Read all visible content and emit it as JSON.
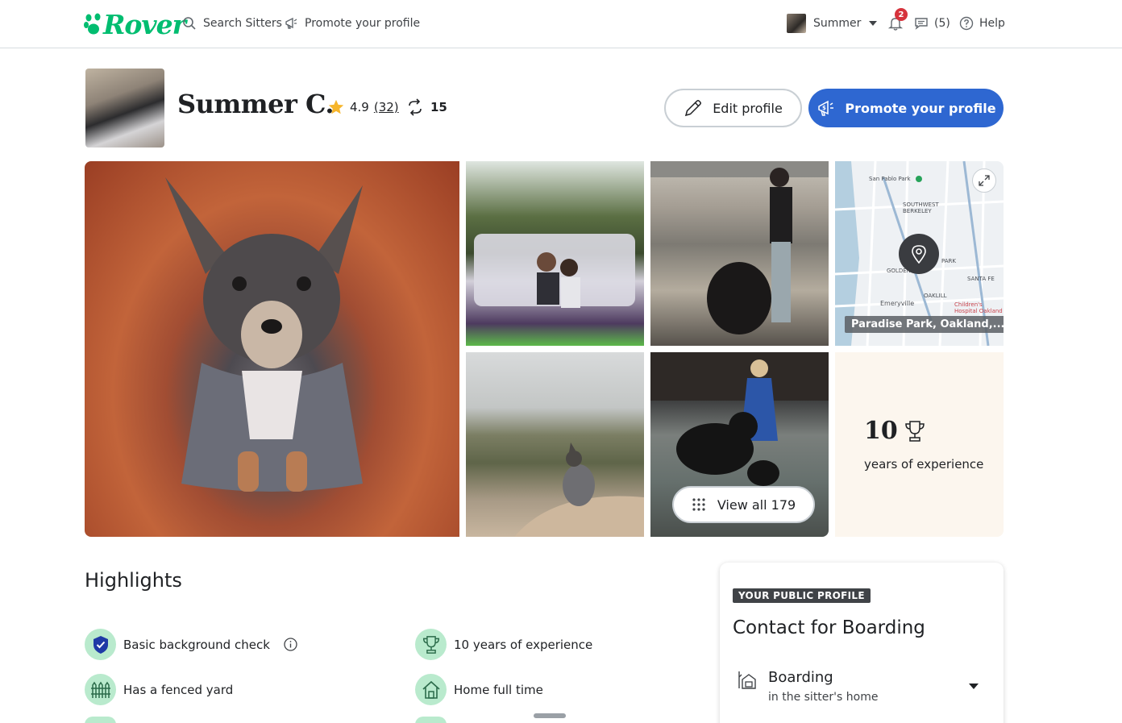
{
  "nav": {
    "brand": "Rover",
    "search_label": "Search Sitters",
    "promote_label": "Promote your profile",
    "user_name": "Summer",
    "notifications_count": "2",
    "messages_label": "(5)",
    "help_label": "Help"
  },
  "profile": {
    "name": "Summer C.",
    "rating": "4.9",
    "review_count": "(32)",
    "repeat_clients": "15",
    "edit_label": "Edit profile",
    "promote_label": "Promote your profile"
  },
  "gallery": {
    "location_label": "Paradise Park, Oakland,...",
    "experience_years": "10",
    "experience_label": "years of experience",
    "view_all_label": "View all 179",
    "map_labels": [
      "San Pablo Park",
      "SOUTHWEST BERKELEY",
      "PARK",
      "GOLDEN",
      "SANTA FE",
      "OAKLILL",
      "Emeryville",
      "Children's Hospital Oakland"
    ]
  },
  "highlights": {
    "title": "Highlights",
    "items": [
      {
        "label": "Basic background check",
        "icon": "shield-check-icon"
      },
      {
        "label": "10 years of experience",
        "icon": "trophy-icon"
      },
      {
        "label": "Has a fenced yard",
        "icon": "fence-icon"
      },
      {
        "label": "Home full time",
        "icon": "house-icon"
      }
    ]
  },
  "contact": {
    "badge": "YOUR PUBLIC PROFILE",
    "title": "Contact for Boarding",
    "service_name": "Boarding",
    "service_sub": "in the sitter's home"
  },
  "colors": {
    "brand_green": "#00bd70",
    "primary_blue": "#2e67d1",
    "highlight_bg": "#b9eacd",
    "notification_red": "#d6333c"
  }
}
